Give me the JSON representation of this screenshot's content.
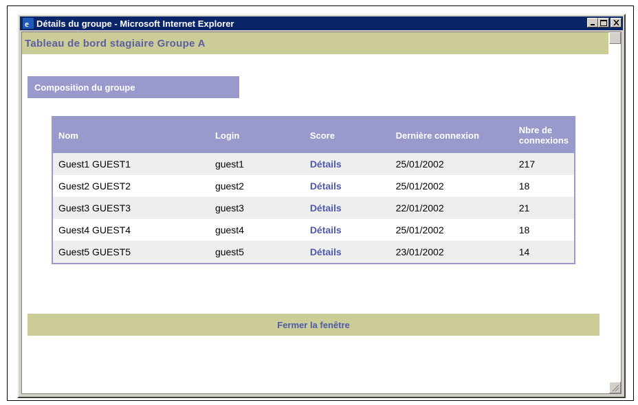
{
  "window": {
    "title": "Détails du groupe - Microsoft Internet Explorer",
    "icon": "ie-logo-icon"
  },
  "header": {
    "title": "Tableau de bord stagiaire Groupe A"
  },
  "section": {
    "title": "Composition du groupe"
  },
  "table": {
    "columns": [
      "Nom",
      "Login",
      "Score",
      "Dernière connexion",
      "Nbre de connexions"
    ],
    "rows": [
      {
        "nom": "Guest1 GUEST1",
        "login": "guest1",
        "score": "Détails",
        "date": "25/01/2002",
        "count": "217"
      },
      {
        "nom": "Guest2 GUEST2",
        "login": "guest2",
        "score": "Détails",
        "date": "25/01/2002",
        "count": "18"
      },
      {
        "nom": "Guest3 GUEST3",
        "login": "guest3",
        "score": "Détails",
        "date": "22/01/2002",
        "count": "21"
      },
      {
        "nom": "Guest4 GUEST4",
        "login": "guest4",
        "score": "Détails",
        "date": "25/01/2002",
        "count": "18"
      },
      {
        "nom": "Guest5 GUEST5",
        "login": "guest5",
        "score": "Détails",
        "date": "23/01/2002",
        "count": "14"
      }
    ]
  },
  "footer": {
    "close_label": "Fermer la fenêtre"
  },
  "colors": {
    "accent_purple": "#9999cc",
    "band_olive": "#cccc99",
    "link_blue": "#4d5aa8",
    "titlebar": "#0a246a"
  }
}
